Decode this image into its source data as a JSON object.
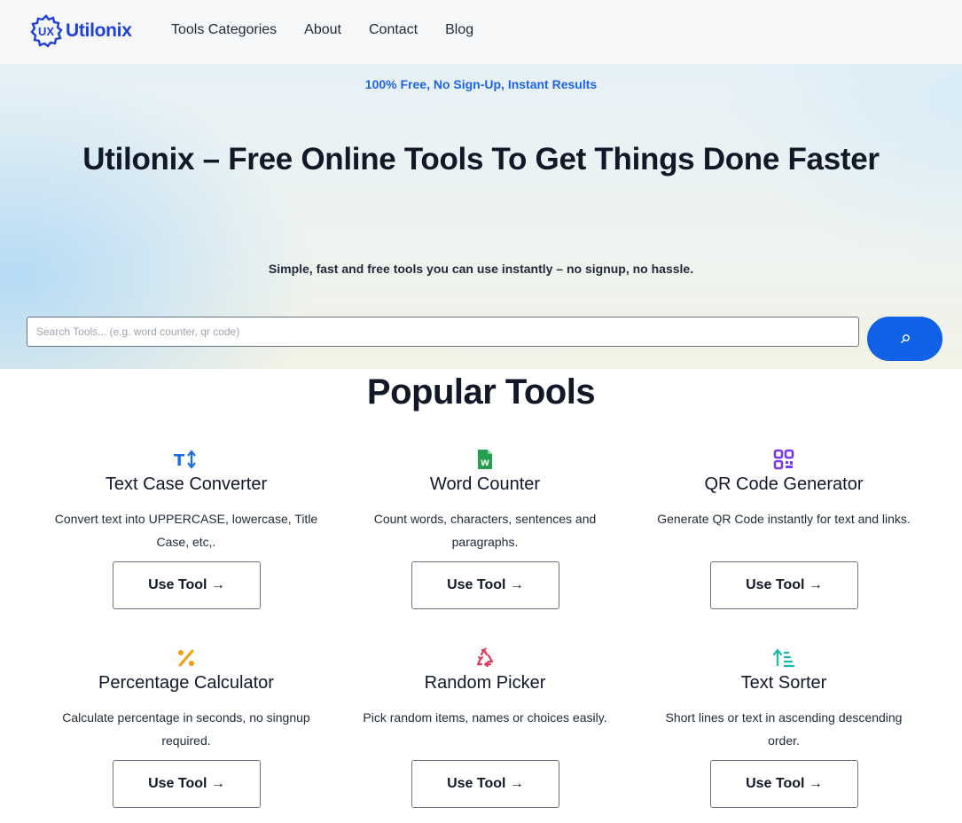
{
  "brand": {
    "name": "Utilonix",
    "logo_text": "UX"
  },
  "nav": {
    "items": [
      "Tools Categories",
      "About",
      "Contact",
      "Blog"
    ]
  },
  "hero": {
    "badge": "100% Free, No Sign-Up, Instant Results",
    "title": "Utilonix – Free Online Tools To Get Things Done Faster",
    "subtitle": "Simple, fast and free tools you can use instantly – no signup, no hassle.",
    "search_placeholder": "Search Tools... (e.g. word counter, qr code)"
  },
  "popular": {
    "heading": "Popular Tools",
    "tools": [
      {
        "title": "Text Case Converter",
        "desc": "Convert text into UPPERCASE, lowercase, Title Case, etc,.",
        "icon": "text-case-icon",
        "color": "#1d6ce0",
        "button": "Use Tool →"
      },
      {
        "title": "Word Counter",
        "desc": "Count words, characters, sentences and paragraphs.",
        "icon": "word-document-icon",
        "color": "#22a04b",
        "button": "Use Tool →"
      },
      {
        "title": "QR Code Generator",
        "desc": "Generate QR Code instantly for text and links.",
        "icon": "qr-code-icon",
        "color": "#7c3aed",
        "button": "Use Tool →"
      },
      {
        "title": "Percentage Calculator",
        "desc": "Calculate percentage in seconds, no singnup required.",
        "icon": "percent-icon",
        "color": "#f59e0b",
        "button": "Use Tool →"
      },
      {
        "title": "Random Picker",
        "desc": "Pick random items, names or choices easily.",
        "icon": "recycle-icon",
        "color": "#e0395c",
        "button": "Use Tool →"
      },
      {
        "title": "Text Sorter",
        "desc": "Short lines or text in ascending descending order.",
        "icon": "sort-ascending-icon",
        "color": "#14b8a6",
        "button": "Use Tool →"
      }
    ]
  },
  "colors": {
    "brand": "#1e40d8",
    "accent": "#1061e6"
  }
}
